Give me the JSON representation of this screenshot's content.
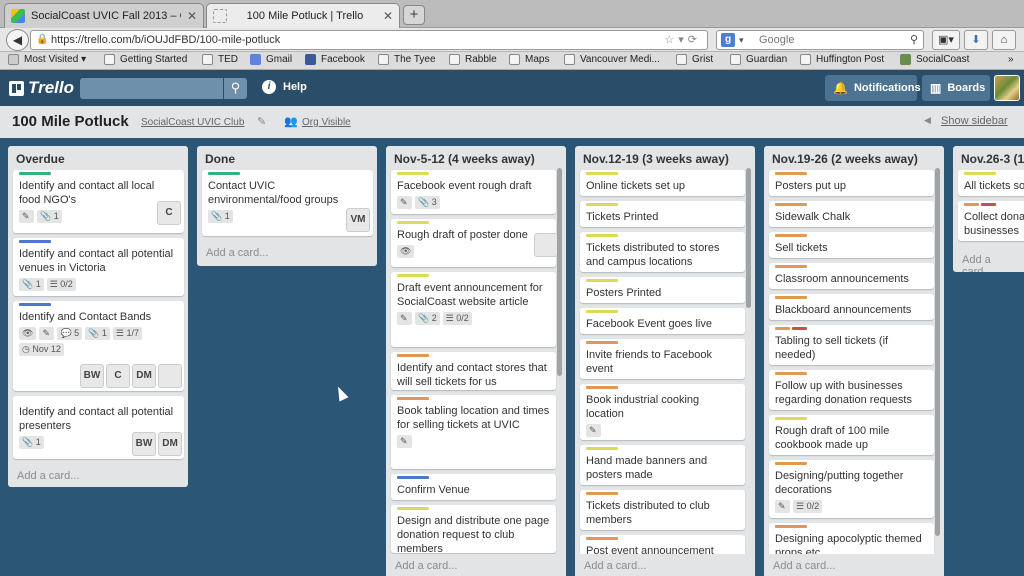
{
  "browser": {
    "tabs": [
      {
        "title": "SocialCoast UVIC Fall 2013 – Go...",
        "active": false,
        "favicon": "google-drive-icon"
      },
      {
        "title": "100 Mile Potluck | Trello",
        "active": true,
        "favicon": "page-icon"
      }
    ],
    "url": "https://trello.com/b/iOUJdFBD/100-mile-potluck",
    "search_placeholder": "Google",
    "bookmarks": [
      "Most Visited",
      "Getting Started",
      "TED",
      "Gmail",
      "Facebook",
      "The Tyee",
      "Rabble",
      "Maps",
      "Vancouver Medi...",
      "Grist",
      "Guardian",
      "Huffington Post",
      "SocialCoast"
    ]
  },
  "topbar": {
    "logo": "Trello",
    "help": "Help",
    "notifications": "Notifications",
    "boards": "Boards"
  },
  "board": {
    "title": "100 Mile Potluck",
    "org": "SocialCoast UVIC Club",
    "visibility": "Org Visible",
    "show_sidebar": "Show sidebar"
  },
  "add_card": "Add a card...",
  "lists": [
    {
      "name": "Overdue",
      "cards": [
        {
          "title": "Identify and contact all local food NGO's",
          "badges": [
            "✎",
            "📎 1"
          ],
          "members": [
            "C"
          ]
        },
        {
          "title": "Identify and contact all potential venues in Victoria",
          "badges": [
            "📎 1",
            "☰ 0/2"
          ]
        },
        {
          "title": "Identify and Contact Bands",
          "badges": [
            "👁",
            "✎",
            "💬 5",
            "📎 1",
            "☰ 1/7"
          ],
          "due": "Nov 12",
          "members": [
            "BW",
            "C",
            "DM"
          ]
        },
        {
          "title": "Identify and contact all potential presenters",
          "badges": [
            "📎 1"
          ],
          "members": [
            "BW",
            "DM"
          ]
        }
      ]
    },
    {
      "name": "Done",
      "cards": [
        {
          "title": "Contact UVIC environmental/food groups",
          "badges": [
            "📎 1"
          ],
          "members": [
            "VM"
          ]
        }
      ]
    },
    {
      "name": "Nov-5-12 (4 weeks away)",
      "cards": [
        {
          "title": "Facebook event rough draft",
          "badges": [
            "✎",
            "📎 3"
          ]
        },
        {
          "title": "Rough draft of poster done",
          "badges": [
            "👁"
          ]
        },
        {
          "title": "Draft event announcement for SocialCoast website article",
          "badges": [
            "✎",
            "📎 2",
            "☰ 0/2"
          ]
        },
        {
          "title": "Identify and contact stores that will sell tickets for us"
        },
        {
          "title": "Book tabling location and times for selling tickets at UVIC",
          "badges": [
            "✎"
          ]
        },
        {
          "title": "Confirm Venue"
        },
        {
          "title": "Design and distribute one page donation request to club members"
        }
      ]
    },
    {
      "name": "Nov.12-19 (3 weeks away)",
      "cards": [
        {
          "title": "Online tickets set up"
        },
        {
          "title": "Tickets Printed"
        },
        {
          "title": "Tickets distributed to stores and campus locations"
        },
        {
          "title": "Posters Printed"
        },
        {
          "title": "Facebook Event goes live"
        },
        {
          "title": "Invite friends to Facebook event"
        },
        {
          "title": "Book industrial cooking location",
          "badges": [
            "✎"
          ]
        },
        {
          "title": "Hand made banners and posters made"
        },
        {
          "title": "Tickets distributed to club members"
        },
        {
          "title": "Post event announcement"
        }
      ]
    },
    {
      "name": "Nov.19-26 (2 weeks away)",
      "cards": [
        {
          "title": "Posters put up"
        },
        {
          "title": "Sidewalk Chalk"
        },
        {
          "title": "Sell tickets"
        },
        {
          "title": "Classroom announcements"
        },
        {
          "title": "Blackboard announcements"
        },
        {
          "title": "Tabling to sell tickets (if needed)"
        },
        {
          "title": "Follow up with businesses regarding donation requests"
        },
        {
          "title": "Rough draft of 100 mile cookbook made up"
        },
        {
          "title": "Designing/putting together decorations",
          "badges": [
            "✎",
            "☰ 0/2"
          ]
        },
        {
          "title": "Designing apocolyptic themed props etc"
        }
      ]
    },
    {
      "name": "Nov.26-3 (1",
      "cards": [
        {
          "title": "All tickets so"
        },
        {
          "title": "Collect dona businesses"
        }
      ]
    }
  ],
  "colors": {
    "green": "#34b27d",
    "blue": "#4d77cb",
    "yellow": "#dbdb57",
    "orange": "#e09952",
    "red": "#cb4d4d",
    "purple": "#93c"
  }
}
